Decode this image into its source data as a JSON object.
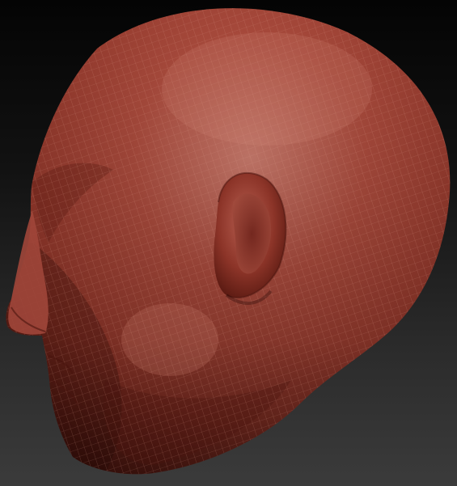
{
  "viewport": {
    "subject": "sculpted-head-model",
    "background_colors": [
      "#040404",
      "#3b3b3b"
    ],
    "model_colors": {
      "base": "#9c3c30",
      "highlight": "#c8786a",
      "shadow": "#4a1610",
      "wireframe": "#e0a090"
    }
  }
}
